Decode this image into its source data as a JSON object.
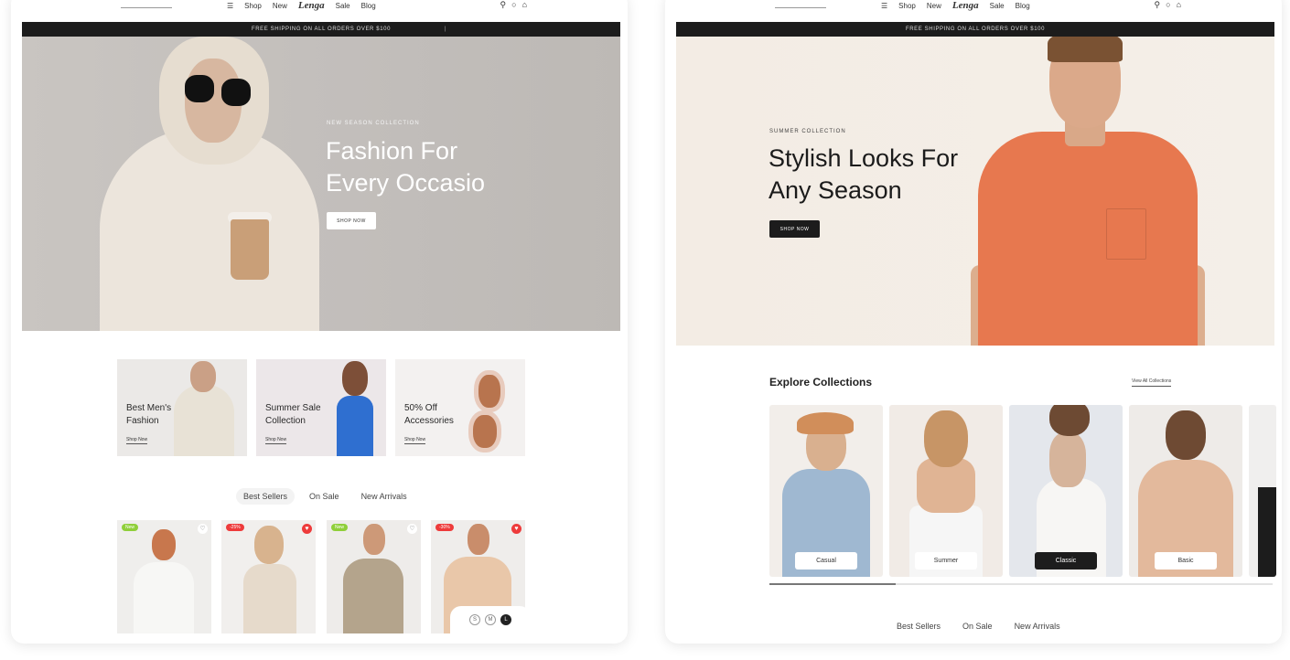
{
  "left": {
    "nav": {
      "links": [
        "Shop",
        "New",
        "Sale",
        "Blog"
      ],
      "brand": "Lenga",
      "icons": [
        "search-icon",
        "user-icon",
        "bag-icon"
      ]
    },
    "announcement": "FREE SHIPPING ON ALL ORDERS OVER $100",
    "hero": {
      "eyebrow": "NEW SEASON COLLECTION",
      "title_line1": "Fashion For",
      "title_line2": "Every Occasio",
      "cta": "SHOP NOW",
      "bg_color": "#c6c2be"
    },
    "collections": [
      {
        "title_line1": "Best Men's",
        "title_line2": "Fashion",
        "link": "Shop Now"
      },
      {
        "title_line1": "Summer Sale",
        "title_line2": "Collection",
        "link": "Shop Now"
      },
      {
        "title_line1": "50% Off",
        "title_line2": "Accessories",
        "link": "Shop Now"
      }
    ],
    "tabs": [
      "Best Sellers",
      "On Sale",
      "New Arrivals"
    ],
    "active_tab": 0,
    "products": [
      {
        "badge": "New",
        "badge_color": "#8fcf3a",
        "heart_active": false
      },
      {
        "badge": "-25%",
        "badge_color": "#ee3b3b",
        "heart_active": true
      },
      {
        "badge": "New",
        "badge_color": "#8fcf3a",
        "heart_active": false
      },
      {
        "badge": "-30%",
        "badge_color": "#ee3b3b",
        "heart_active": true
      }
    ],
    "sizes": [
      "S",
      "M",
      "L"
    ]
  },
  "right": {
    "nav": {
      "links": [
        "Shop",
        "New",
        "Sale",
        "Blog"
      ],
      "brand": "Lenga",
      "icons": [
        "search-icon",
        "user-icon",
        "bag-icon"
      ]
    },
    "announcement": "FREE SHIPPING ON ALL ORDERS OVER $100",
    "hero": {
      "eyebrow": "SUMMER COLLECTION",
      "title_line1": "Stylish Looks For",
      "title_line2": "Any Season",
      "cta": "SHOP NOW",
      "bg_color": "#f3ede5",
      "shirt_color": "#e7784f"
    },
    "section_title": "Explore Collections",
    "view_all": "View All Collections",
    "collections": [
      {
        "label": "Casual",
        "dark": false
      },
      {
        "label": "Summer",
        "dark": false
      },
      {
        "label": "Classic",
        "dark": true
      },
      {
        "label": "Basic",
        "dark": false
      }
    ],
    "carousel_progress": 0.25,
    "tabs": [
      "Best Sellers",
      "On Sale",
      "New Arrivals"
    ]
  }
}
